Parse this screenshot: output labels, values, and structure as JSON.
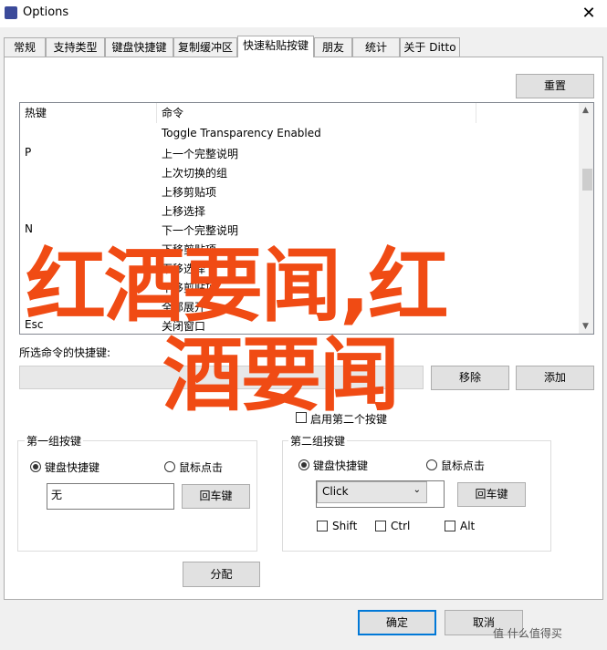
{
  "window": {
    "title": "Options",
    "close_label": "✕"
  },
  "tabs": [
    {
      "label": "常规"
    },
    {
      "label": "支持类型"
    },
    {
      "label": "键盘快捷键"
    },
    {
      "label": "复制缓冲区"
    },
    {
      "label": "快速粘贴按键"
    },
    {
      "label": "朋友"
    },
    {
      "label": "统计"
    },
    {
      "label": "关于 Ditto"
    }
  ],
  "reset_button": "重置",
  "list": {
    "columns": [
      "热键",
      "命令"
    ],
    "rows": [
      {
        "key": "",
        "command": "Toggle Transparency Enabled"
      },
      {
        "key": "P",
        "command": "上一个完整说明"
      },
      {
        "key": "",
        "command": "上次切换的组"
      },
      {
        "key": "",
        "command": "上移剪贴项"
      },
      {
        "key": "",
        "command": "上移选择"
      },
      {
        "key": "N",
        "command": "下一个完整说明"
      },
      {
        "key": "",
        "command": "下移剪贴项"
      },
      {
        "key": "",
        "command": "下移选择"
      },
      {
        "key": "",
        "command": "下移剪贴项"
      },
      {
        "key": "",
        "command": "全部展开"
      },
      {
        "key": "Esc",
        "command": "关闭窗口"
      }
    ]
  },
  "shortcut_section": {
    "label": "所选命令的快捷键:",
    "remove_button": "移除",
    "add_button": "添加",
    "checkbox_label": "启用第二个按键"
  },
  "group1": {
    "legend": "第一组按键",
    "radio_keyboard": "键盘快捷键",
    "radio_mouse": "鼠标点击",
    "input_value": "无",
    "enter_button": "回车键"
  },
  "group2": {
    "legend": "第二组按键",
    "radio_keyboard": "键盘快捷键",
    "radio_mouse": "鼠标点击",
    "select_value": "Click",
    "enter_button": "回车键",
    "shift_label": "Shift",
    "ctrl_label": "Ctrl",
    "alt_label": "Alt"
  },
  "assign_button": "分配",
  "ok_button": "确定",
  "cancel_button": "取消",
  "watermark": {
    "line1": "红酒要闻,红",
    "line2": "酒要闻"
  },
  "footer_watermark": "值 什么值得买",
  "colors": {
    "accent": "#0078d7",
    "watermark": "#f04b14"
  }
}
